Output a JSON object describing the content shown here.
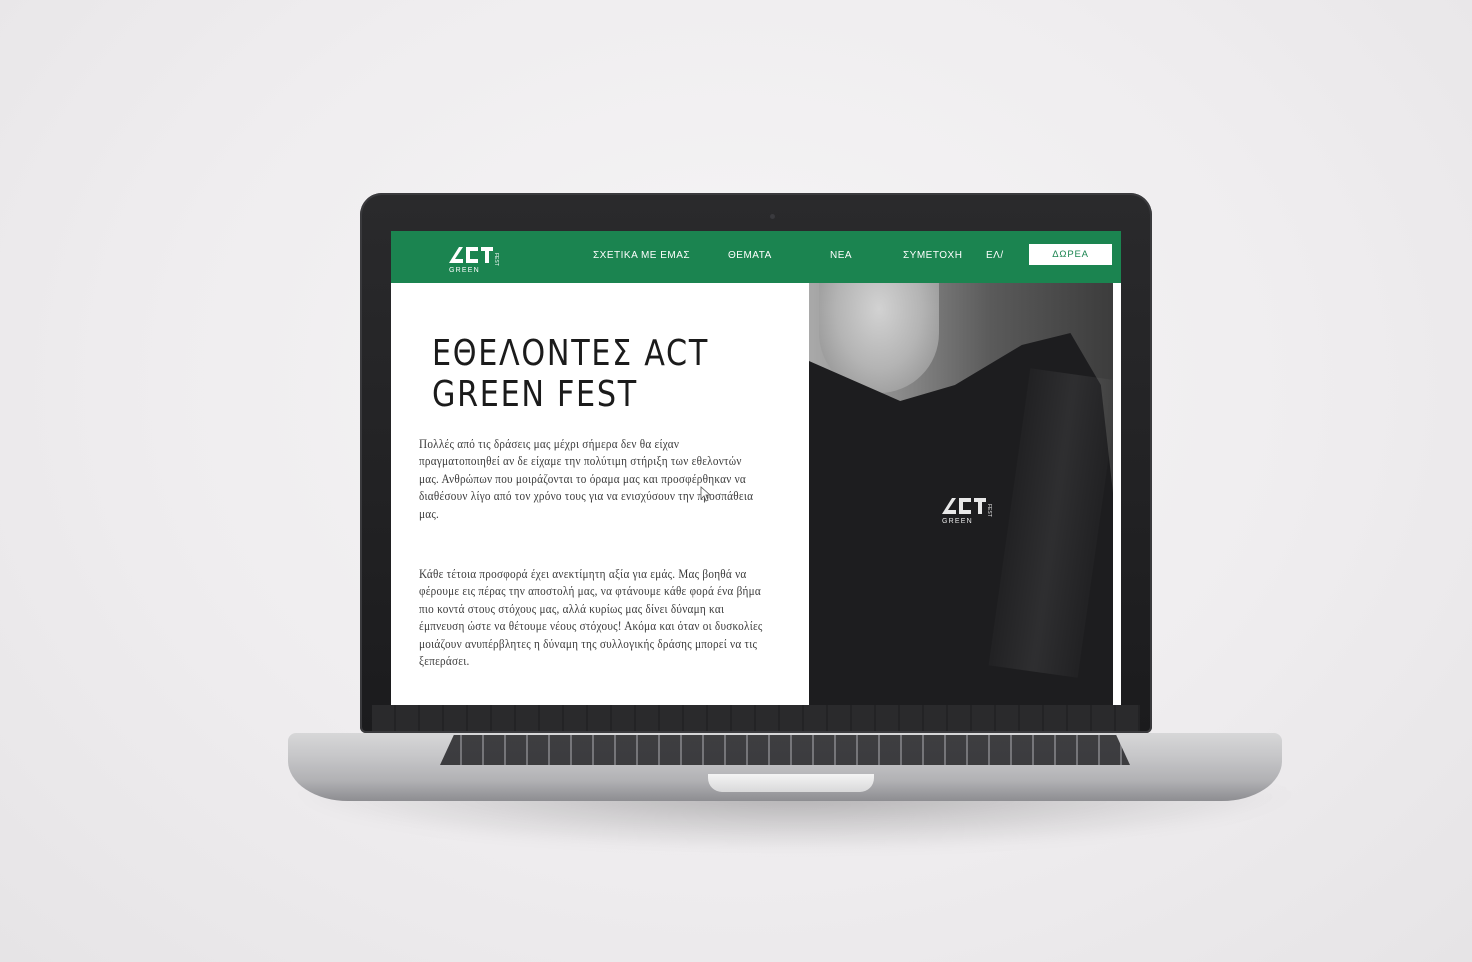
{
  "colors": {
    "brand_green": "#1b8450",
    "nav_text": "#ffffff",
    "title_text": "#1b1b1b",
    "body_text": "#3a3a3a"
  },
  "logo": {
    "word_top": "ACT",
    "word_bottom": "GREEN",
    "word_side": "FEST"
  },
  "nav": {
    "items": [
      "ΣΧΕΤΙΚΑ ΜΕ ΕΜΑΣ",
      "ΘΕΜΑΤΑ",
      "ΝΕΑ",
      "ΣΥΜΕΤΟΧΗ",
      "ΕΛ/"
    ],
    "donate_label": "ΔΩΡΕΑ"
  },
  "hero": {
    "title_line1": "ΕΘΕΛΟΝΤΕΣ ACT",
    "title_line2": "GREEN FEST",
    "paragraph1": "Πολλές από τις δράσεις μας μέχρι σήμερα δεν θα είχαν πραγματοποιηθεί αν δε είχαμε την πολύτιμη στήριξη των εθελοντών μας. Ανθρώπων που μοιράζονται το όραμα μας και προσφέρθηκαν να διαθέσουν λίγο από τον χρόνο τους για να ενισχύσουν την προσπάθεια μας.",
    "paragraph2": "Κάθε τέτοια προσφορά έχει ανεκτίμητη αξία για εμάς. Μας βοηθά να φέρουμε εις πέρας την αποστολή μας, να φτάνουμε κάθε φορά ένα βήμα πιο κοντά στους στόχους μας, αλλά κυρίως μας δίνει δύναμη και έμπνευση ώστε να θέτουμε νέους στόχους! Ακόμα και όταν οι δυσκολίες μοιάζουν ανυπέρβλητες η δύναμη της συλλογικής δράσης μπορεί να τις ξεπεράσει."
  },
  "icons": {
    "logo": "act-green-fest-logo",
    "cursor": "mouse-pointer-icon"
  }
}
